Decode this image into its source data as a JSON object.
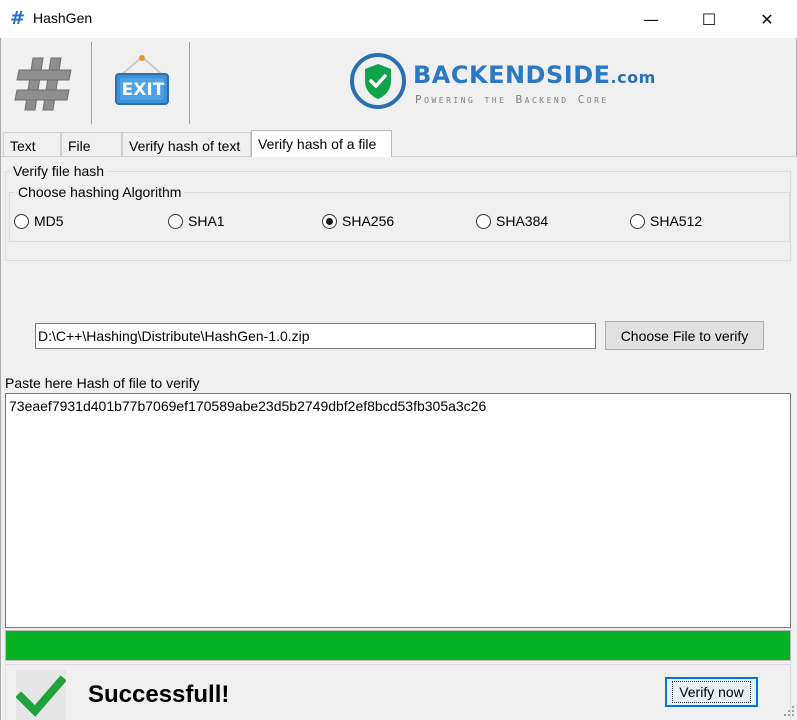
{
  "window": {
    "title": "HashGen",
    "app_icon_glyph": "#",
    "controls": {
      "minimize": "—",
      "maximize": "☐",
      "close": "✕"
    }
  },
  "toolbar": {
    "hash_icon": "hash-logo-icon",
    "exit_label": "EXIT"
  },
  "brand": {
    "name": "BACKENDSIDE",
    "domain": ".com",
    "tagline": "Powering the Backend Core",
    "colors": {
      "primary": "#2b79c2",
      "shield": "#11a34a",
      "ring": "#2b6fb3"
    }
  },
  "tabs": [
    {
      "label": "Text",
      "active": false
    },
    {
      "label": "File",
      "active": false
    },
    {
      "label": "Verify hash of text",
      "active": false
    },
    {
      "label": "Verify hash of a file",
      "active": true
    }
  ],
  "verify_group": {
    "legend": "Verify file hash",
    "algorithm_group": {
      "legend": "Choose hashing Algorithm",
      "options": [
        {
          "label": "MD5",
          "selected": false
        },
        {
          "label": "SHA1",
          "selected": false
        },
        {
          "label": "SHA256",
          "selected": true
        },
        {
          "label": "SHA384",
          "selected": false
        },
        {
          "label": "SHA512",
          "selected": false
        }
      ]
    }
  },
  "file": {
    "path": "D:\\C++\\Hashing\\Distribute\\HashGen-1.0.zip",
    "choose_button_label": "Choose File to verify"
  },
  "hash_input": {
    "label": "Paste here Hash of file to verify",
    "value": "73eaef7931d401b77b7069ef170589abe23d5b2749dbf2ef8bcd53fb305a3c26"
  },
  "progress": {
    "percent": 100,
    "color": "#06b025"
  },
  "result": {
    "status_text": "Successfull!",
    "status_icon": "checkmark-icon",
    "check_color": "#1fa33a",
    "verify_button_label": "Verify now"
  }
}
